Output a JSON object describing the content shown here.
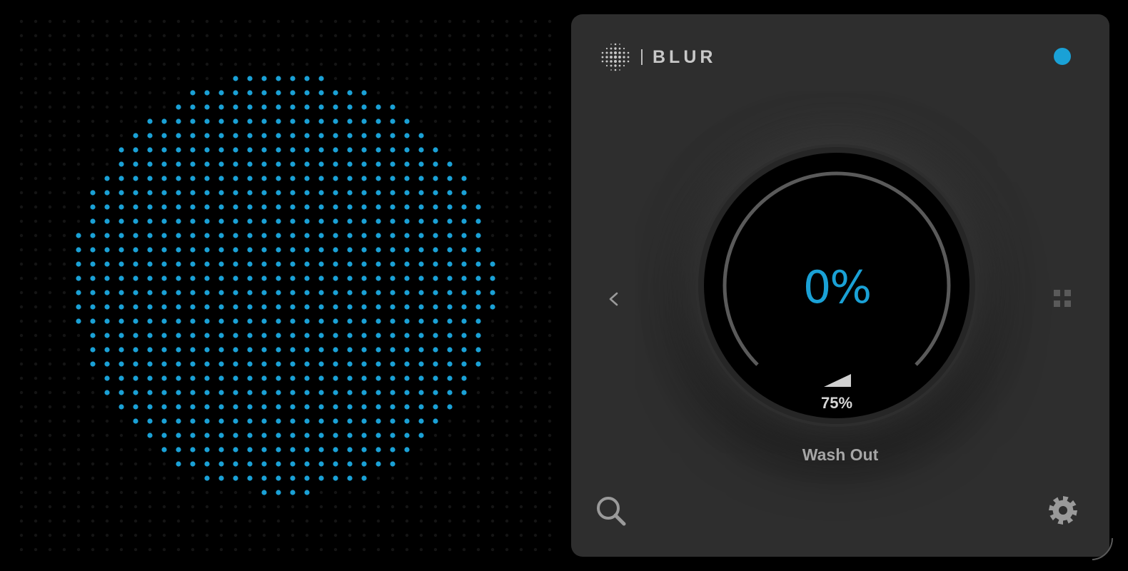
{
  "app": {
    "brand": "BLUR",
    "brand_divider": "|"
  },
  "header": {
    "logo_icon": "dotted-sphere-icon",
    "status_icon": "status-dot-icon"
  },
  "knob": {
    "value": "0%",
    "value_fraction": 0.0,
    "volume": "75%",
    "volume_fraction": 0.75,
    "volume_icon": "volume-wedge-icon"
  },
  "mode": {
    "label": "Wash Out"
  },
  "controls": {
    "prev_icon": "chevron-left-icon",
    "grid_icon": "grid-handle-icon",
    "search_icon": "search-icon",
    "settings_icon": "gear-icon",
    "resize_icon": "resize-corner-icon"
  },
  "colors": {
    "accent": "#1aa1d6",
    "panel": "#2e2e2e",
    "background": "#000000",
    "knob_ring": "#262626",
    "arc": "#5a5a5a",
    "faint_dot": "#141414"
  }
}
